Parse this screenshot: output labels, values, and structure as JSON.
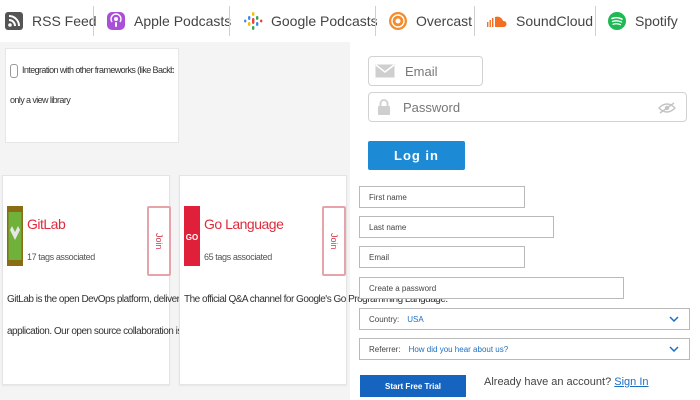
{
  "podcast_links": [
    {
      "label": "RSS Feed"
    },
    {
      "label": "Apple Podcasts"
    },
    {
      "label": "Google Podcasts"
    },
    {
      "label": "Overcast"
    },
    {
      "label": "SoundCloud"
    },
    {
      "label": "Spotify"
    }
  ],
  "feature_option": {
    "text_line1": "Integration with other frameworks (like Backbone.js, Angular, etc) becomes easier because it is",
    "text_line2": "only a view library"
  },
  "communities": [
    {
      "name": "GitLab",
      "tags": "17 tags associated",
      "join": "Join",
      "description_line1": "GitLab is the open DevOps platform, delivered as a single",
      "description_line2": "application. Our open source collaboration is a great place to sha..."
    },
    {
      "name": "Go Language",
      "tags": "65 tags associated",
      "join": "Join",
      "description_line1": "The official Q&A channel for Google's Go Programming Language.",
      "description_line2": ""
    }
  ],
  "login": {
    "email_placeholder": "Email",
    "password_placeholder": "Password",
    "button": "Log in"
  },
  "signup": {
    "first_name": "First name",
    "last_name": "Last name",
    "email": "Email",
    "password": "Create a password",
    "country_label": "Country:",
    "country_value": "USA",
    "referrer_label": "Referrer:",
    "referrer_value": "How did you hear about us?",
    "button": "Start Free Trial",
    "already_text": "Already have an account?",
    "sign_in": "Sign In"
  }
}
